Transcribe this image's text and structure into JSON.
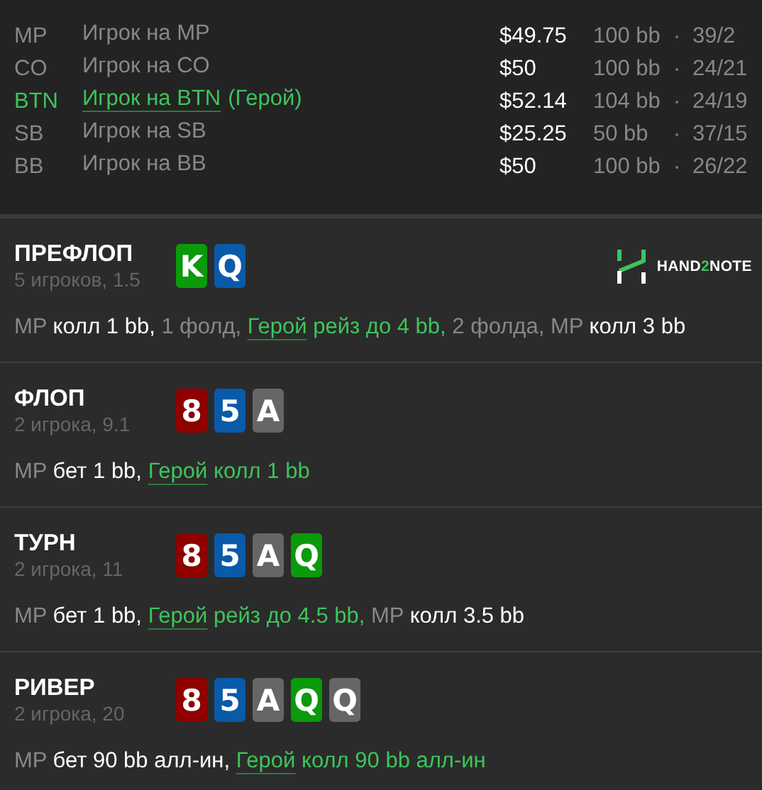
{
  "players": [
    {
      "position": "MP",
      "name": "Игрок на MP",
      "hero": false,
      "stack": "$49.75",
      "bb": "100 bb",
      "stats": "39/2"
    },
    {
      "position": "CO",
      "name": "Игрок на CO",
      "hero": false,
      "stack": "$50",
      "bb": "100 bb",
      "stats": "24/21"
    },
    {
      "position": "BTN",
      "name": "Игрок на BTN",
      "hero": true,
      "hero_tag": "(Герой)",
      "stack": "$52.14",
      "bb": "104 bb",
      "stats": "24/19"
    },
    {
      "position": "SB",
      "name": "Игрок на SB",
      "hero": false,
      "stack": "$25.25",
      "bb": "50 bb",
      "stats": "37/15"
    },
    {
      "position": "BB",
      "name": "Игрок на BB",
      "hero": false,
      "stack": "$50",
      "bb": "100 bb",
      "stats": "26/22"
    }
  ],
  "streets": [
    {
      "title": "ПРЕФЛОП",
      "subtitle": "5 игроков, 1.5",
      "logo": {
        "before": "HAND",
        "accent": "2",
        "after": "NOTE"
      },
      "cards": [
        {
          "rank": "K",
          "color": "#0a9a0a"
        },
        {
          "rank": "Q",
          "color": "#0a5aaa"
        }
      ],
      "actions": [
        {
          "kind": "position",
          "text": "MP"
        },
        {
          "kind": "action",
          "text": "колл 1 bb,"
        },
        {
          "kind": "fold",
          "text": "1 фолд,"
        },
        {
          "kind": "hero",
          "text": "Герой"
        },
        {
          "kind": "hero-action",
          "text": "рейз до 4 bb,"
        },
        {
          "kind": "fold",
          "text": "2 фолда,"
        },
        {
          "kind": "position",
          "text": "MP"
        },
        {
          "kind": "action",
          "text": "колл 3 bb"
        }
      ]
    },
    {
      "title": "ФЛОП",
      "subtitle": "2 игрока, 9.1",
      "cards": [
        {
          "rank": "8",
          "color": "#8f0000"
        },
        {
          "rank": "5",
          "color": "#0a5aaa"
        },
        {
          "rank": "A",
          "color": "#666666"
        }
      ],
      "actions": [
        {
          "kind": "position",
          "text": "MP"
        },
        {
          "kind": "action",
          "text": "бет 1 bb,"
        },
        {
          "kind": "hero",
          "text": "Герой"
        },
        {
          "kind": "hero-action",
          "text": "колл 1 bb"
        }
      ]
    },
    {
      "title": "ТУРН",
      "subtitle": "2 игрока, 11",
      "cards": [
        {
          "rank": "8",
          "color": "#8f0000"
        },
        {
          "rank": "5",
          "color": "#0a5aaa"
        },
        {
          "rank": "A",
          "color": "#666666"
        },
        {
          "rank": "Q",
          "color": "#0a9a0a"
        }
      ],
      "actions": [
        {
          "kind": "position",
          "text": "MP"
        },
        {
          "kind": "action",
          "text": "бет 1 bb,"
        },
        {
          "kind": "hero",
          "text": "Герой"
        },
        {
          "kind": "hero-action",
          "text": "рейз до 4.5 bb,"
        },
        {
          "kind": "position",
          "text": "MP"
        },
        {
          "kind": "action",
          "text": "колл 3.5 bb"
        }
      ]
    },
    {
      "title": "РИВЕР",
      "subtitle": "2 игрока, 20",
      "cards": [
        {
          "rank": "8",
          "color": "#8f0000"
        },
        {
          "rank": "5",
          "color": "#0a5aaa"
        },
        {
          "rank": "A",
          "color": "#666666"
        },
        {
          "rank": "Q",
          "color": "#0a9a0a"
        },
        {
          "rank": "Q",
          "color": "#666666"
        }
      ],
      "actions": [
        {
          "kind": "position",
          "text": "MP"
        },
        {
          "kind": "action",
          "text": "бет 90 bb алл-ин,"
        },
        {
          "kind": "hero",
          "text": "Герой"
        },
        {
          "kind": "hero-action",
          "text": "колл 90 bb алл-ин"
        }
      ]
    }
  ]
}
